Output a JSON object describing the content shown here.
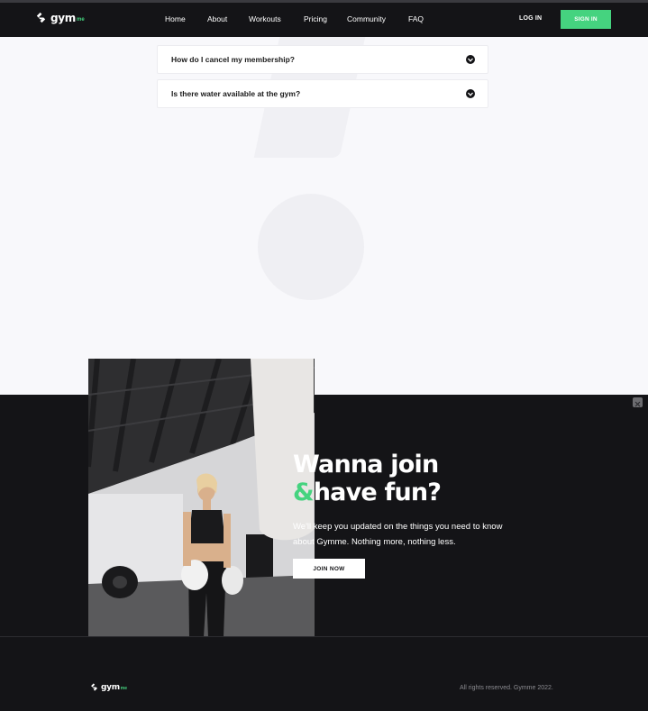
{
  "brand": {
    "name": "gym",
    "suffix": "me"
  },
  "nav": {
    "links": [
      "Home",
      "About",
      "Workouts",
      "Pricing",
      "Community",
      "FAQ"
    ],
    "login_label": "LOG IN",
    "signin_label": "SIGN IN"
  },
  "faq": {
    "items": [
      {
        "question": "How do I cancel my membership?"
      },
      {
        "question": "Is there water available at the gym?"
      }
    ]
  },
  "cta": {
    "title_line1": "Wanna join",
    "title_amp": "&",
    "title_line2": "have fun?",
    "text": "We'll keep you updated on the things you need to know about Gymme. Nothing more, nothing less.",
    "button_label": "JOIN NOW"
  },
  "footer": {
    "copyright": "All rights reserved. Gymme 2022."
  },
  "colors": {
    "accent": "#45d37f",
    "dark": "#141417",
    "light_bg": "#f8f8fb"
  },
  "icons": [
    "logo-mark-icon",
    "chevron-down-icon",
    "close-icon"
  ]
}
